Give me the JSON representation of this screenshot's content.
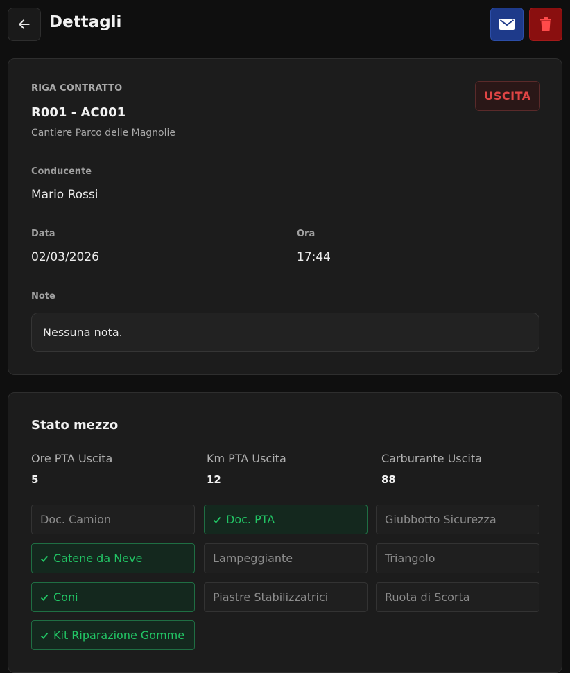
{
  "header": {
    "title": "Dettagli",
    "back_icon": "arrow-left-icon",
    "mail_icon": "mail-icon",
    "delete_icon": "trash-icon"
  },
  "details": {
    "riga_label": "RIGA CONTRATTO",
    "riga_code": "R001 - AC001",
    "site": "Cantiere Parco delle Magnolie",
    "status": "USCITA",
    "driver_label": "Conducente",
    "driver": "Mario Rossi",
    "date_label": "Data",
    "date": "02/03/2026",
    "time_label": "Ora",
    "time": "17:44",
    "notes_label": "Note",
    "notes": "Nessuna nota."
  },
  "stato": {
    "title": "Stato mezzo",
    "stats": [
      {
        "label": "Ore PTA Uscita",
        "value": "5"
      },
      {
        "label": "Km PTA Uscita",
        "value": "12"
      },
      {
        "label": "Carburante Uscita",
        "value": "88"
      }
    ],
    "checklist": [
      {
        "label": "Doc. Camion",
        "checked": false
      },
      {
        "label": "Doc. PTA",
        "checked": true
      },
      {
        "label": "Giubbotto Sicurezza",
        "checked": false
      },
      {
        "label": "Catene da Neve",
        "checked": true
      },
      {
        "label": "Lampeggiante",
        "checked": false
      },
      {
        "label": "Triangolo",
        "checked": false
      },
      {
        "label": "Coni",
        "checked": true
      },
      {
        "label": "Piastre Stabilizzatrici",
        "checked": false
      },
      {
        "label": "Ruota di Scorta",
        "checked": false
      },
      {
        "label": "Kit Riparazione Gomme",
        "checked": true
      }
    ]
  },
  "colors": {
    "background": "#0f0f0f",
    "card": "#1c1c1c",
    "status_red": "#e04545",
    "mail_blue": "#1e3a8a",
    "delete_red": "#8a0f0f",
    "checked_green": "#22c565"
  }
}
